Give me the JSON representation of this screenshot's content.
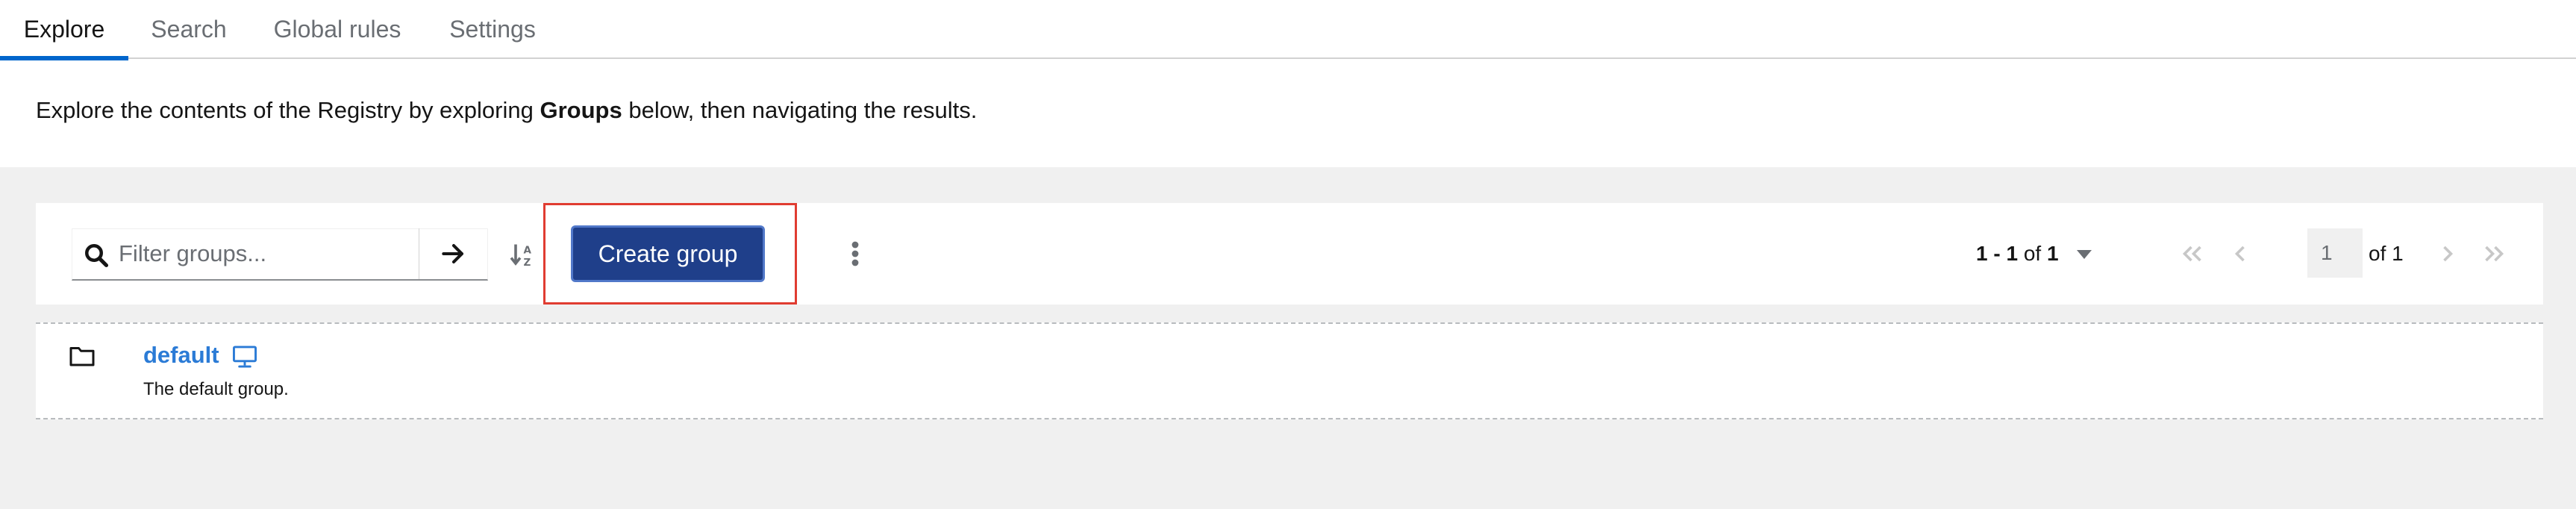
{
  "tabs": [
    {
      "label": "Explore",
      "active": true
    },
    {
      "label": "Search",
      "active": false
    },
    {
      "label": "Global rules",
      "active": false
    },
    {
      "label": "Settings",
      "active": false
    }
  ],
  "description": {
    "before": "Explore the contents of the Registry by exploring ",
    "bold": "Groups",
    "after": " below, then navigating the results."
  },
  "toolbar": {
    "search_placeholder": "Filter groups...",
    "search_icon": "search-icon",
    "submit_icon": "arrow-right-icon",
    "sort_icon": "sort-alpha-icon",
    "create_label": "Create group",
    "kebab_icon": "kebab-icon"
  },
  "pagination": {
    "range": "1 - 1",
    "of_label": "of",
    "total": "1",
    "page_value": "1",
    "pages_label": "of 1"
  },
  "groups": [
    {
      "name": "default",
      "description": "The default group.",
      "icon": "folder-icon",
      "badge_icon": "monitor-icon"
    }
  ],
  "colors": {
    "accent": "#0066cc",
    "primary_button": "#1f3f8a",
    "link": "#2b7bd6",
    "highlight": "#e03c31",
    "background_gray": "#f0f0f0"
  }
}
